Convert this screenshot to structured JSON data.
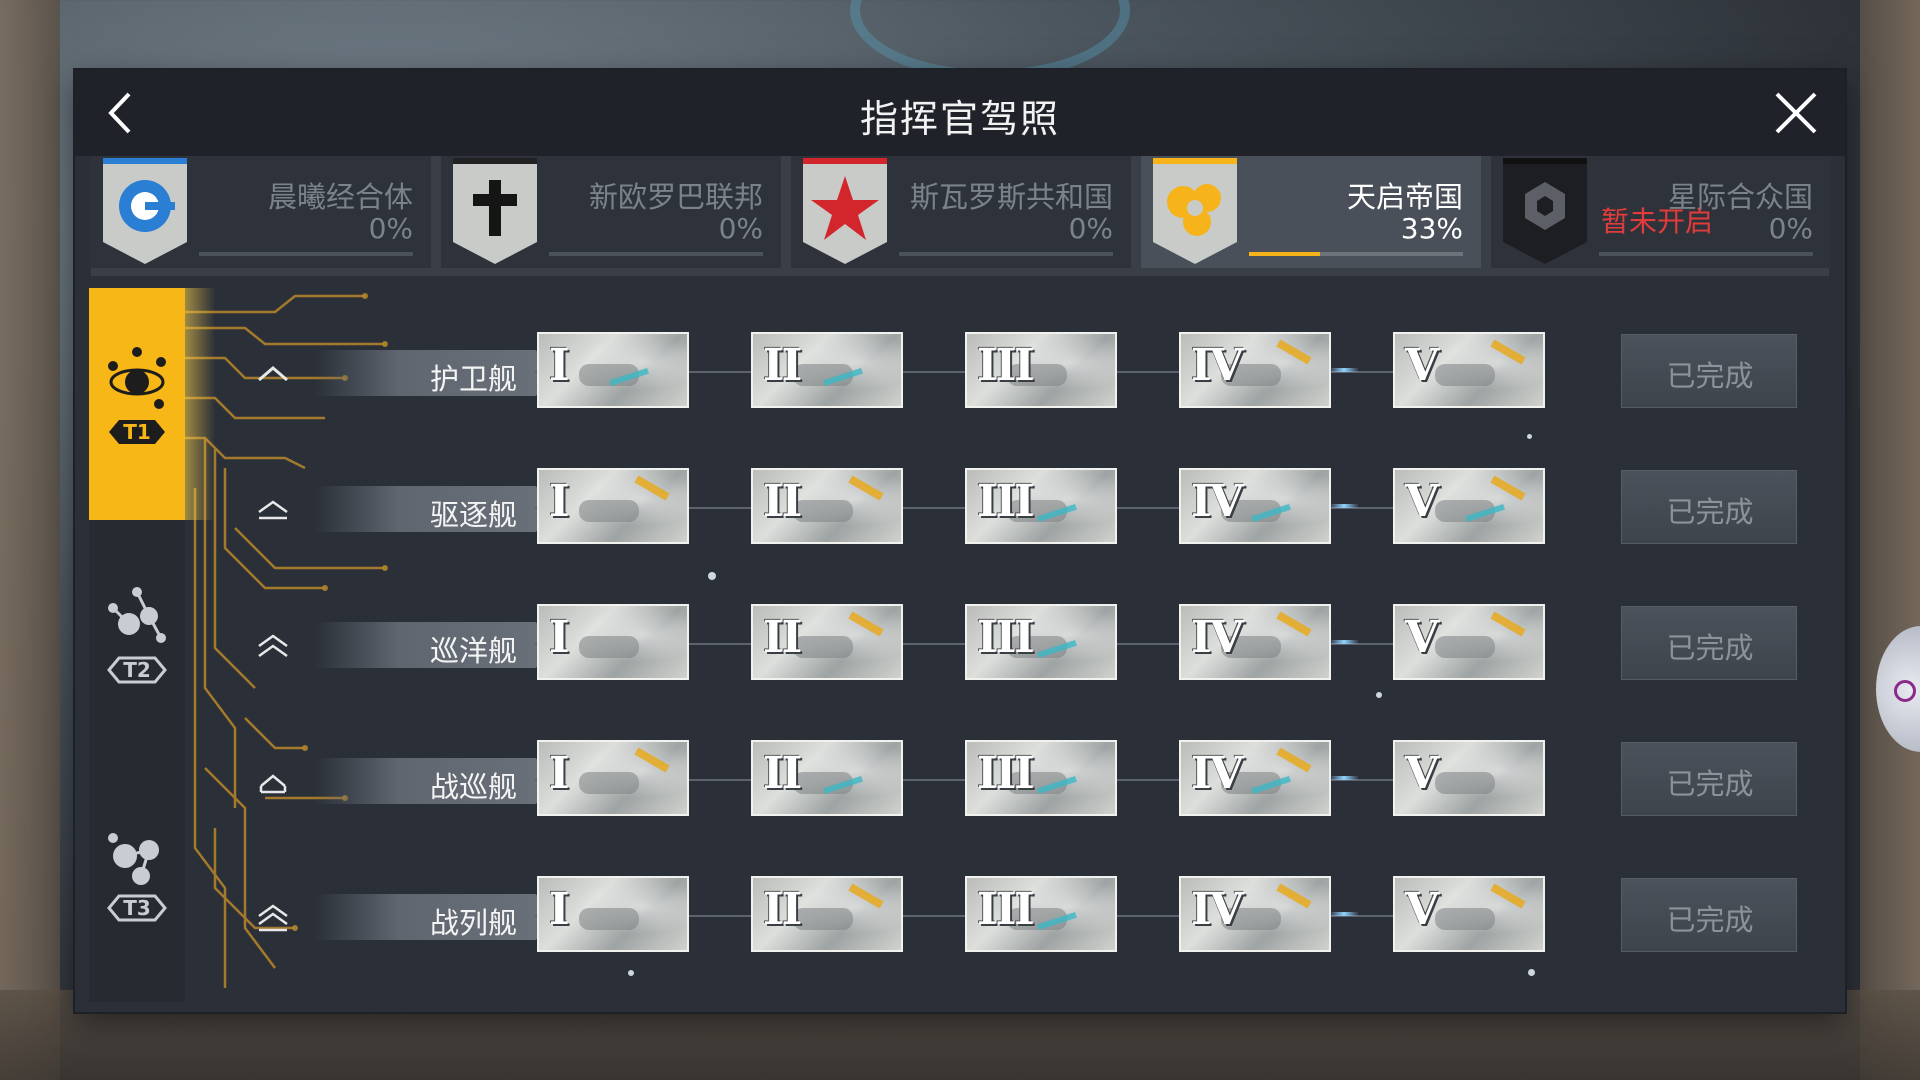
{
  "title": "指挥官驾照",
  "icons": {
    "back": "back-arrow-icon",
    "close": "close-icon"
  },
  "factions": [
    {
      "name": "晨曦经合体",
      "percent": "0%",
      "progress": 0,
      "emblem": "blue-circle-emblem",
      "color": "#2a7fd4",
      "active": false
    },
    {
      "name": "新欧罗巴联邦",
      "percent": "0%",
      "progress": 0,
      "emblem": "cross-emblem",
      "color": "#222222",
      "active": false
    },
    {
      "name": "斯瓦罗斯共和国",
      "percent": "0%",
      "progress": 0,
      "emblem": "red-star-emblem",
      "color": "#d3262c",
      "active": false
    },
    {
      "name": "天启帝国",
      "percent": "33%",
      "progress": 0.33,
      "emblem": "gold-orbs-emblem",
      "color": "#f6b31a",
      "active": true
    },
    {
      "name": "星际合众国",
      "percent": "0%",
      "progress": 0,
      "emblem": "black-hexagon-emblem",
      "color": "#111111",
      "active": false,
      "locked_text": "暂未开启"
    }
  ],
  "tiers": [
    {
      "label": "T1",
      "active": true
    },
    {
      "label": "T2",
      "active": false
    },
    {
      "label": "T3",
      "active": false
    }
  ],
  "ship_classes": [
    {
      "name": "护卫舰",
      "levels": [
        "I",
        "II",
        "III",
        "IV",
        "V"
      ],
      "status": "已完成"
    },
    {
      "name": "驱逐舰",
      "levels": [
        "I",
        "II",
        "III",
        "IV",
        "V"
      ],
      "status": "已完成"
    },
    {
      "name": "巡洋舰",
      "levels": [
        "I",
        "II",
        "III",
        "IV",
        "V"
      ],
      "status": "已完成"
    },
    {
      "name": "战巡舰",
      "levels": [
        "I",
        "II",
        "III",
        "IV",
        "V"
      ],
      "status": "已完成"
    },
    {
      "name": "战列舰",
      "levels": [
        "I",
        "II",
        "III",
        "IV",
        "V"
      ],
      "status": "已完成"
    }
  ],
  "accent_color": "#f7b717"
}
